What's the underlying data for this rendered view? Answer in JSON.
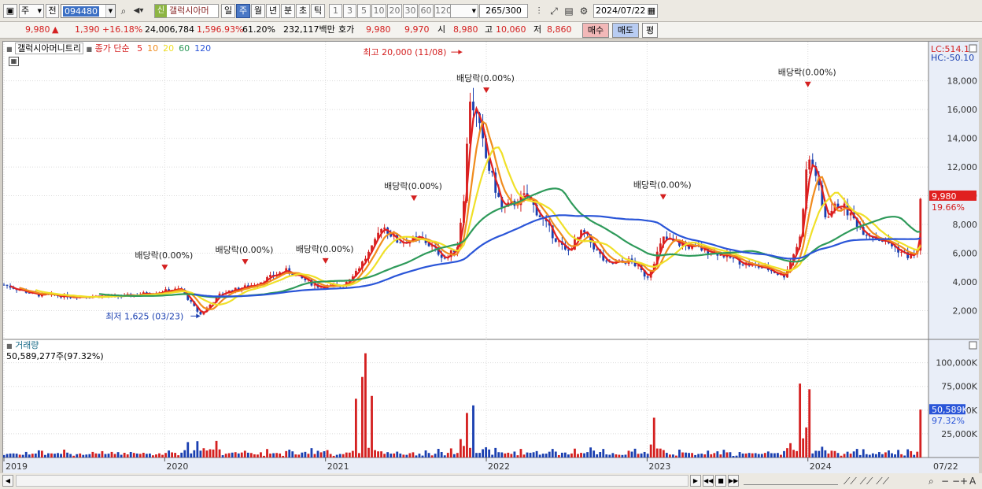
{
  "toolbar": {
    "period_select": "주",
    "nav_select": "전",
    "stock_code": "094480",
    "new_badge": "신",
    "stock_name": "갤럭시아머",
    "periods": [
      "일",
      "주",
      "월",
      "년",
      "분",
      "초",
      "틱"
    ],
    "active_period": "주",
    "intervals": [
      "1",
      "3",
      "5",
      "10",
      "20",
      "30",
      "60",
      "120"
    ],
    "count": "265",
    "count_max": "/300",
    "date": "2024/07/22"
  },
  "quote": {
    "price": "9,980",
    "change_arrow": "▲",
    "change": "1,390",
    "change_pct": "+16.18%",
    "volume": "24,006,784",
    "volume_ratio": "1,596.93%",
    "turnover": "61.20%",
    "amount": "232,117백만",
    "bid_label": "호가",
    "ask_price": "9,980",
    "bid_price": "9,970",
    "open_label": "시",
    "open": "8,980",
    "high_label": "고",
    "high": "10,060",
    "low_label": "저",
    "low": "8,860",
    "buy_label": "매수",
    "sell_label": "매도",
    "eval_label": "평"
  },
  "chart": {
    "stock_label": "갤럭시아머니트리",
    "legend_main": "종가 단순",
    "ma_periods": [
      "5",
      "10",
      "20",
      "60",
      "120"
    ],
    "ma_colors": [
      "#e02020",
      "#f08c1e",
      "#f0e028",
      "#2e9a5a",
      "#2a55d8"
    ],
    "lc": "LC:514.15",
    "hc": "HC:-50.10",
    "last_price_tag": "9,980",
    "last_change_tag": "19.66%",
    "high_note": "최고 20,000 (11/08)",
    "low_note": "최저 1,625 (03/23)",
    "dividend_label": "배당락(0.00%)",
    "volume_title": "거래량",
    "volume_info": "50,589,277주(97.32%)",
    "volume_tag": "50,589K",
    "volume_pct_tag": "97.32%",
    "last_date_tag": "07/22",
    "up_color": "#d42020",
    "down_color": "#1a3fb0"
  },
  "chart_data": {
    "type": "candlestick",
    "price_axis": {
      "ticks": [
        2000,
        4000,
        6000,
        8000,
        10000,
        12000,
        14000,
        16000,
        18000
      ],
      "tick_labels": [
        "2,000",
        "4,000",
        "6,000",
        "8,000",
        "10,000",
        "12,000",
        "14,000",
        "16,000",
        "18,000"
      ],
      "range": [
        0,
        20500
      ]
    },
    "volume_axis": {
      "ticks": [
        25000,
        50000,
        75000,
        100000
      ],
      "tick_labels": [
        "25,000K",
        "50,000K",
        "75,000K",
        "100,000K"
      ],
      "range": [
        0,
        118000
      ]
    },
    "x_axis": {
      "ticks": [
        2019,
        2020,
        2021,
        2022,
        2023,
        2024
      ],
      "tick_labels": [
        "2019",
        "2020",
        "2021",
        "2022",
        "2023",
        "2024"
      ],
      "range": [
        2019.0,
        2024.75
      ]
    },
    "close_keypoints": [
      [
        2019.0,
        3800
      ],
      [
        2019.2,
        3100
      ],
      [
        2019.45,
        3000
      ],
      [
        2019.75,
        3000
      ],
      [
        2019.95,
        3300
      ],
      [
        2020.1,
        3500
      ],
      [
        2020.22,
        1700
      ],
      [
        2020.35,
        3200
      ],
      [
        2020.55,
        3800
      ],
      [
        2020.75,
        4800
      ],
      [
        2020.95,
        3700
      ],
      [
        2021.1,
        3700
      ],
      [
        2021.2,
        4900
      ],
      [
        2021.3,
        6500
      ],
      [
        2021.35,
        8000
      ],
      [
        2021.45,
        6800
      ],
      [
        2021.6,
        7000
      ],
      [
        2021.75,
        5600
      ],
      [
        2021.82,
        6500
      ],
      [
        2021.86,
        10000
      ],
      [
        2021.9,
        17000
      ],
      [
        2021.95,
        15000
      ],
      [
        2022.0,
        12500
      ],
      [
        2022.1,
        9000
      ],
      [
        2022.25,
        10000
      ],
      [
        2022.4,
        7500
      ],
      [
        2022.5,
        6000
      ],
      [
        2022.6,
        7500
      ],
      [
        2022.75,
        5200
      ],
      [
        2022.9,
        5500
      ],
      [
        2023.0,
        4300
      ],
      [
        2023.1,
        7000
      ],
      [
        2023.25,
        6500
      ],
      [
        2023.45,
        6000
      ],
      [
        2023.6,
        5300
      ],
      [
        2023.75,
        4900
      ],
      [
        2023.85,
        4400
      ],
      [
        2023.95,
        7000
      ],
      [
        2024.0,
        12800
      ],
      [
        2024.05,
        11500
      ],
      [
        2024.1,
        8500
      ],
      [
        2024.2,
        9500
      ],
      [
        2024.35,
        7500
      ],
      [
        2024.5,
        6700
      ],
      [
        2024.62,
        5800
      ],
      [
        2024.68,
        6000
      ],
      [
        2024.7,
        9980
      ]
    ],
    "series": [
      {
        "name": "5",
        "window": 2,
        "color": "#e02020"
      },
      {
        "name": "10",
        "window": 5,
        "color": "#f08c1e"
      },
      {
        "name": "20",
        "window": 10,
        "color": "#f0e028"
      },
      {
        "name": "60",
        "window": 30,
        "color": "#2e9a5a"
      },
      {
        "name": "120",
        "window": 60,
        "color": "#2a55d8"
      }
    ],
    "dividend_markers": [
      2020.0,
      2020.5,
      2021.0,
      2021.55,
      2022.0,
      2023.1,
      2024.0
    ],
    "high": {
      "x": 2021.85,
      "value": 20000
    },
    "low": {
      "x": 2020.22,
      "value": 1625
    }
  }
}
